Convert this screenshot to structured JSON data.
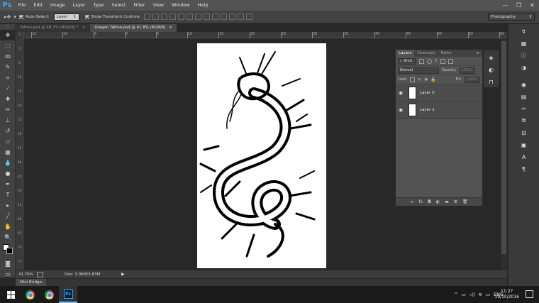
{
  "app": {
    "logo": "Ps"
  },
  "menu": [
    "File",
    "Edit",
    "Image",
    "Layer",
    "Type",
    "Select",
    "Filter",
    "View",
    "Window",
    "Help"
  ],
  "window_controls": [
    "—",
    "❐",
    "✕"
  ],
  "options": {
    "auto_select_label": "Auto-Select:",
    "auto_select_value": "Layer",
    "transform_label": "Show Transform Controls",
    "workspace": "Photography"
  },
  "tabs": [
    {
      "label": "Tattoo.psd @ 48.7% (RGB/8) *",
      "close": "×",
      "active": false
    },
    {
      "label": "Dragon Tattoo.psd @ 41.8% (RGB/8)",
      "close": "×",
      "active": true
    }
  ],
  "ruler": {
    "h_ticks": [
      "15",
      "10",
      "5",
      "0",
      "5",
      "10",
      "15",
      "20",
      "25",
      "30",
      "35",
      "40",
      "45",
      "50",
      "55",
      "60"
    ],
    "v_ticks": [
      "5",
      "0",
      "5",
      "10",
      "15",
      "20",
      "25",
      "30",
      "35",
      "40",
      "45",
      "50",
      "55",
      "60",
      "65",
      "70",
      "75"
    ]
  },
  "status": {
    "zoom": "41.76%",
    "doc": "Doc: 3.06M/3.83M"
  },
  "mini_bridge": "Mini Bridge",
  "layers_panel": {
    "tabs": [
      "Layers",
      "Channels",
      "Paths"
    ],
    "kind": "Kind",
    "blend": "Normal",
    "opacity_label": "Opacity:",
    "opacity_value": "100%",
    "lock_label": "Lock:",
    "fill_label": "Fill:",
    "fill_value": "100%",
    "layers": [
      {
        "name": "Layer 0"
      },
      {
        "name": "Layer 2"
      }
    ]
  },
  "taskbar": {
    "lang": "ENG",
    "time": "11:27",
    "date": "19/10/2016"
  },
  "colors": {
    "ps_blue": "#31a8ff",
    "panel": "#535353",
    "taskbar": "#1a1a1a"
  }
}
